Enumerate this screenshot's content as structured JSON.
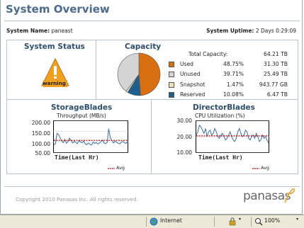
{
  "header": {
    "title": "System Overview",
    "system_name_label": "System Name:",
    "system_name": "paneast",
    "uptime_label": "System Uptime:",
    "uptime": "2 Days 0:29:09"
  },
  "status_panel": {
    "title": "System Status",
    "warning_label": "warning",
    "warning_color": "#f0a020"
  },
  "capacity_panel": {
    "title": "Capacity",
    "total_label": "Total Capacity:",
    "total_value": "64.21 TB",
    "rows": [
      {
        "name": "Used",
        "pct": "48.75%",
        "size": "31.30 TB",
        "color": "#d86f10"
      },
      {
        "name": "Unused",
        "pct": "39.71%",
        "size": "25.49 TB",
        "color": "#d4d4d4"
      },
      {
        "name": "Snapshot",
        "pct": "1.47%",
        "size": "943.77 GB",
        "color": "#e9e0c0"
      },
      {
        "name": "Reserved",
        "pct": "10.08%",
        "size": "6.47 TB",
        "color": "#1f5f8f"
      }
    ]
  },
  "storage_panel": {
    "title": "StorageBlades",
    "subtitle": "Throughput (MB/s)",
    "xlabel": "Time(Last Hr)",
    "avg_label": "Avg",
    "y_ticks": [
      "200.00",
      "150.00",
      "100.00",
      "50.00"
    ]
  },
  "director_panel": {
    "title": "DirectorBlades",
    "subtitle": "CPU Utilization (%)",
    "xlabel": "Time(Last Hr)",
    "avg_label": "Avg",
    "y_ticks": [
      "30.00",
      "20.00",
      "10.00"
    ]
  },
  "chart_data": [
    {
      "type": "line",
      "title": "StorageBlades",
      "subtitle": "Throughput (MB/s)",
      "xlabel": "Time(Last Hr)",
      "ylabel": "",
      "ylim": [
        50,
        200
      ],
      "y_ticks": [
        50,
        100,
        150,
        200
      ],
      "series": [
        {
          "name": "",
          "color": "#3a6ea5",
          "values": [
            88,
            92,
            140,
            135,
            120,
            105,
            98,
            112,
            95,
            102,
            118,
            108,
            96,
            104,
            99,
            93,
            107,
            101,
            97,
            105,
            92,
            88,
            96,
            90,
            86,
            100,
            94,
            98,
            91,
            95,
            102,
            110,
            96,
            93,
            98,
            162,
            120,
            108,
            96,
            104,
            100,
            95,
            92,
            99,
            103,
            97,
            94,
            101
          ]
        },
        {
          "name": "Avg",
          "color": "#cc0000",
          "values": [
            108
          ]
        }
      ]
    },
    {
      "type": "line",
      "title": "DirectorBlades",
      "subtitle": "CPU Utilization (%)",
      "xlabel": "Time(Last Hr)",
      "ylabel": "",
      "ylim": [
        10,
        30
      ],
      "y_ticks": [
        10,
        20,
        30
      ],
      "series": [
        {
          "name": "",
          "color": "#3a6ea5",
          "values": [
            21,
            23,
            27,
            26,
            24,
            22,
            25,
            20,
            23,
            24,
            21,
            22,
            25,
            23,
            20,
            19,
            21,
            22,
            20,
            18,
            19,
            21,
            23,
            20,
            18,
            17,
            19,
            23,
            25,
            22,
            20,
            21,
            24,
            23,
            19,
            18,
            20,
            21,
            19,
            22,
            20,
            17,
            18,
            21,
            19,
            20,
            18,
            16
          ]
        },
        {
          "name": "Avg",
          "color": "#cc0000",
          "values": [
            20.5
          ]
        }
      ]
    }
  ],
  "footer": {
    "copyright": "Copyright 2010 Panasas Inc.   All rights reserved.",
    "logo_text": "panasas"
  },
  "statusbar": {
    "zone": "Internet",
    "zoom": "100%",
    "zone_icon": "globe-icon",
    "lock_icon": "lock-icon"
  }
}
